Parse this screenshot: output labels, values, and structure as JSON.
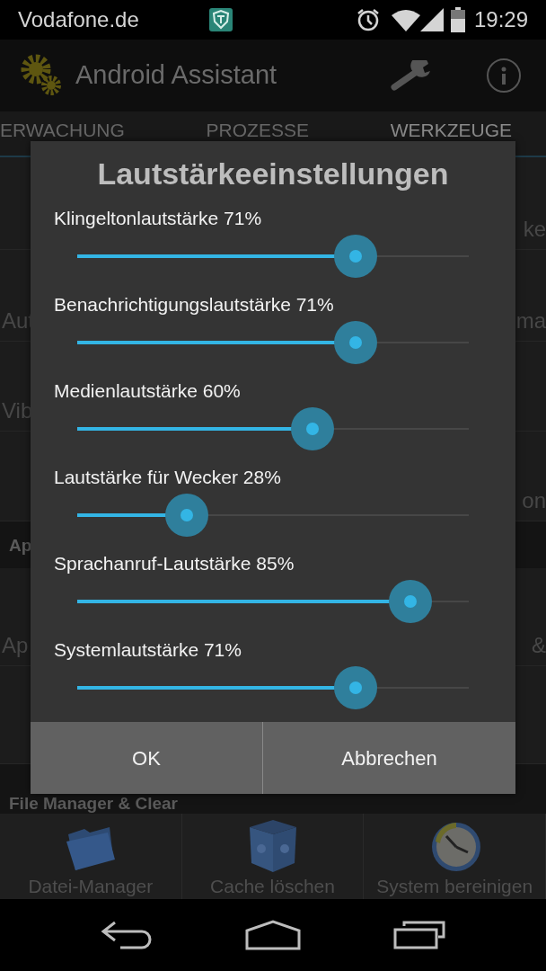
{
  "status_bar": {
    "carrier": "Vodafone.de",
    "time": "19:29"
  },
  "action_bar": {
    "title": "Android Assistant"
  },
  "tabs": [
    {
      "label": "ERWACHUNG",
      "selected": false
    },
    {
      "label": "PROZESSE",
      "selected": false
    },
    {
      "label": "WERKZEUGE",
      "selected": true
    }
  ],
  "background": [
    {
      "kind": "row",
      "right": "ke"
    },
    {
      "kind": "row",
      "left": "Aut",
      "right": "ma"
    },
    {
      "kind": "row",
      "left": "Vib"
    },
    {
      "kind": "row",
      "right": "on"
    },
    {
      "kind": "header",
      "left": "Ap"
    },
    {
      "kind": "row",
      "left": "Ap",
      "right": "&"
    },
    {
      "kind": "row"
    },
    {
      "kind": "header",
      "left": "File Manager & Clear"
    }
  ],
  "tiles": [
    {
      "kind": "folder",
      "label": "Datei-Manager"
    },
    {
      "kind": "box",
      "label": "Cache löschen"
    },
    {
      "kind": "clock",
      "label": "System bereinigen"
    }
  ],
  "dialog": {
    "title": "Lautstärkeeinstellungen",
    "sliders": [
      {
        "label": "Klingeltonlautstärke 71%",
        "level": 0.71
      },
      {
        "label": "Benachrichtigungslautstärke 71%",
        "level": 0.71
      },
      {
        "label": "Medienlautstärke 60%",
        "level": 0.6
      },
      {
        "label": "Lautstärke für Wecker 28%",
        "level": 0.28
      },
      {
        "label": "Sprachanruf-Lautstärke 85%",
        "level": 0.85
      },
      {
        "label": "Systemlautstärke 71%",
        "level": 0.71
      }
    ],
    "buttons": [
      "OK",
      "Abbrechen"
    ]
  }
}
